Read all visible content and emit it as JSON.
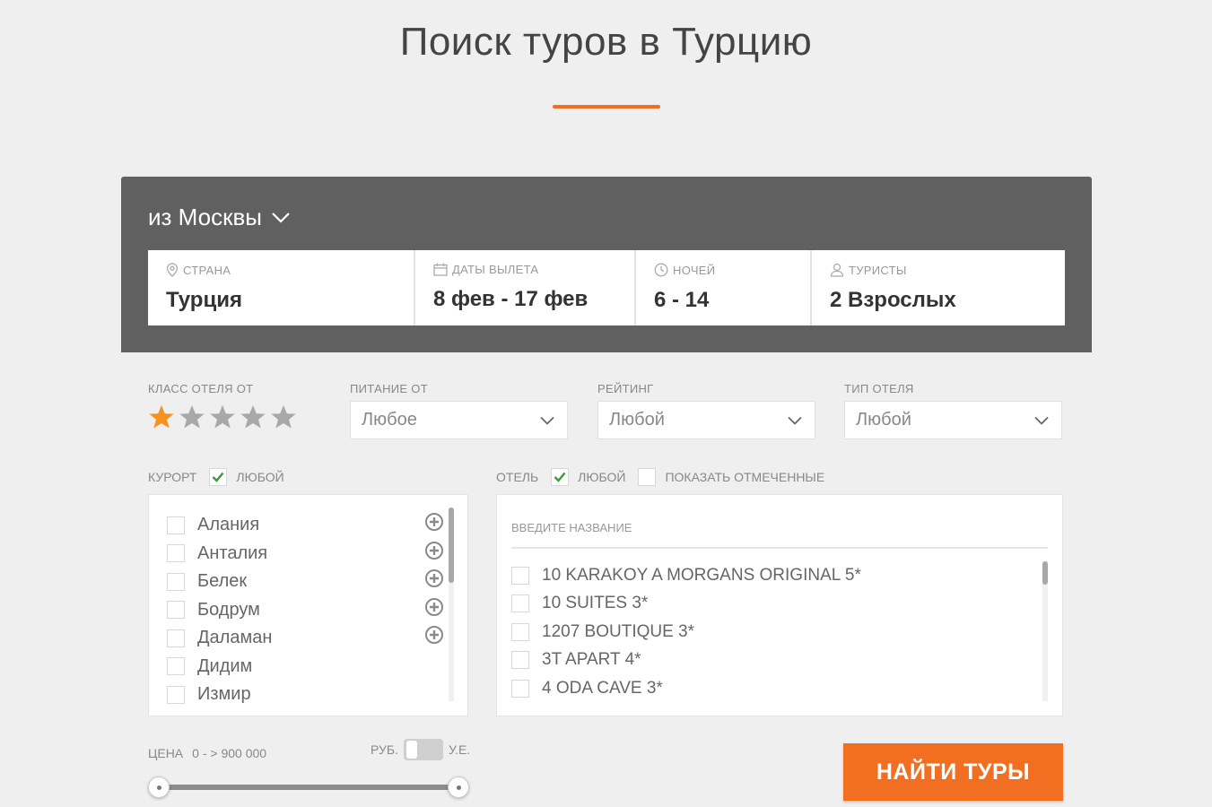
{
  "page": {
    "title": "Поиск туров в Турцию"
  },
  "colors": {
    "accent": "#f26f21",
    "panel": "#606060",
    "check": "#3a9a3a",
    "star_active": "#f6921e",
    "star_inactive": "#a8a8a8"
  },
  "search": {
    "departure": "из Москвы",
    "fields": [
      {
        "label": "Страна",
        "value": "Турция",
        "icon": "location-pin-icon"
      },
      {
        "label": "Даты вылета",
        "value": "8 фев - 17 фев",
        "icon": "calendar-icon"
      },
      {
        "label": "Ночей",
        "value": "6 - 14",
        "icon": "clock-icon"
      },
      {
        "label": "Туристы",
        "value": "2 Взрослых",
        "icon": "person-icon"
      }
    ]
  },
  "filters": {
    "hotel_class_label": "Класс отеля от",
    "hotel_class_rating": 1,
    "hotel_class_max": 5,
    "meal_label": "Питание от",
    "meal_value": "Любое",
    "rating_label": "Рейтинг",
    "rating_value": "Любой",
    "hotel_type_label": "Тип отеля",
    "hotel_type_value": "Любой"
  },
  "resort": {
    "label": "Курорт",
    "any_label": "любой",
    "any_checked": true,
    "items": [
      "Алания",
      "Анталия",
      "Белек",
      "Бодрум",
      "Даламан",
      "Дидим",
      "Измир"
    ]
  },
  "hotel": {
    "label": "Отель",
    "any_label": "любой",
    "any_checked": true,
    "show_marked_label": "показать отмеченные",
    "search_placeholder": "Введите название",
    "items": [
      "10 KARAKOY A MORGANS ORIGINAL 5*",
      "10 SUITES 3*",
      "1207 BOUTIQUE 3*",
      "3T APART 4*",
      "4 ODA CAVE 3*"
    ]
  },
  "price": {
    "label": "Цена",
    "range": "0 - > 900 000",
    "currency_left": "РУБ.",
    "currency_right": "У.Е."
  },
  "actions": {
    "find_label": "НАЙТИ ТУРЫ"
  }
}
